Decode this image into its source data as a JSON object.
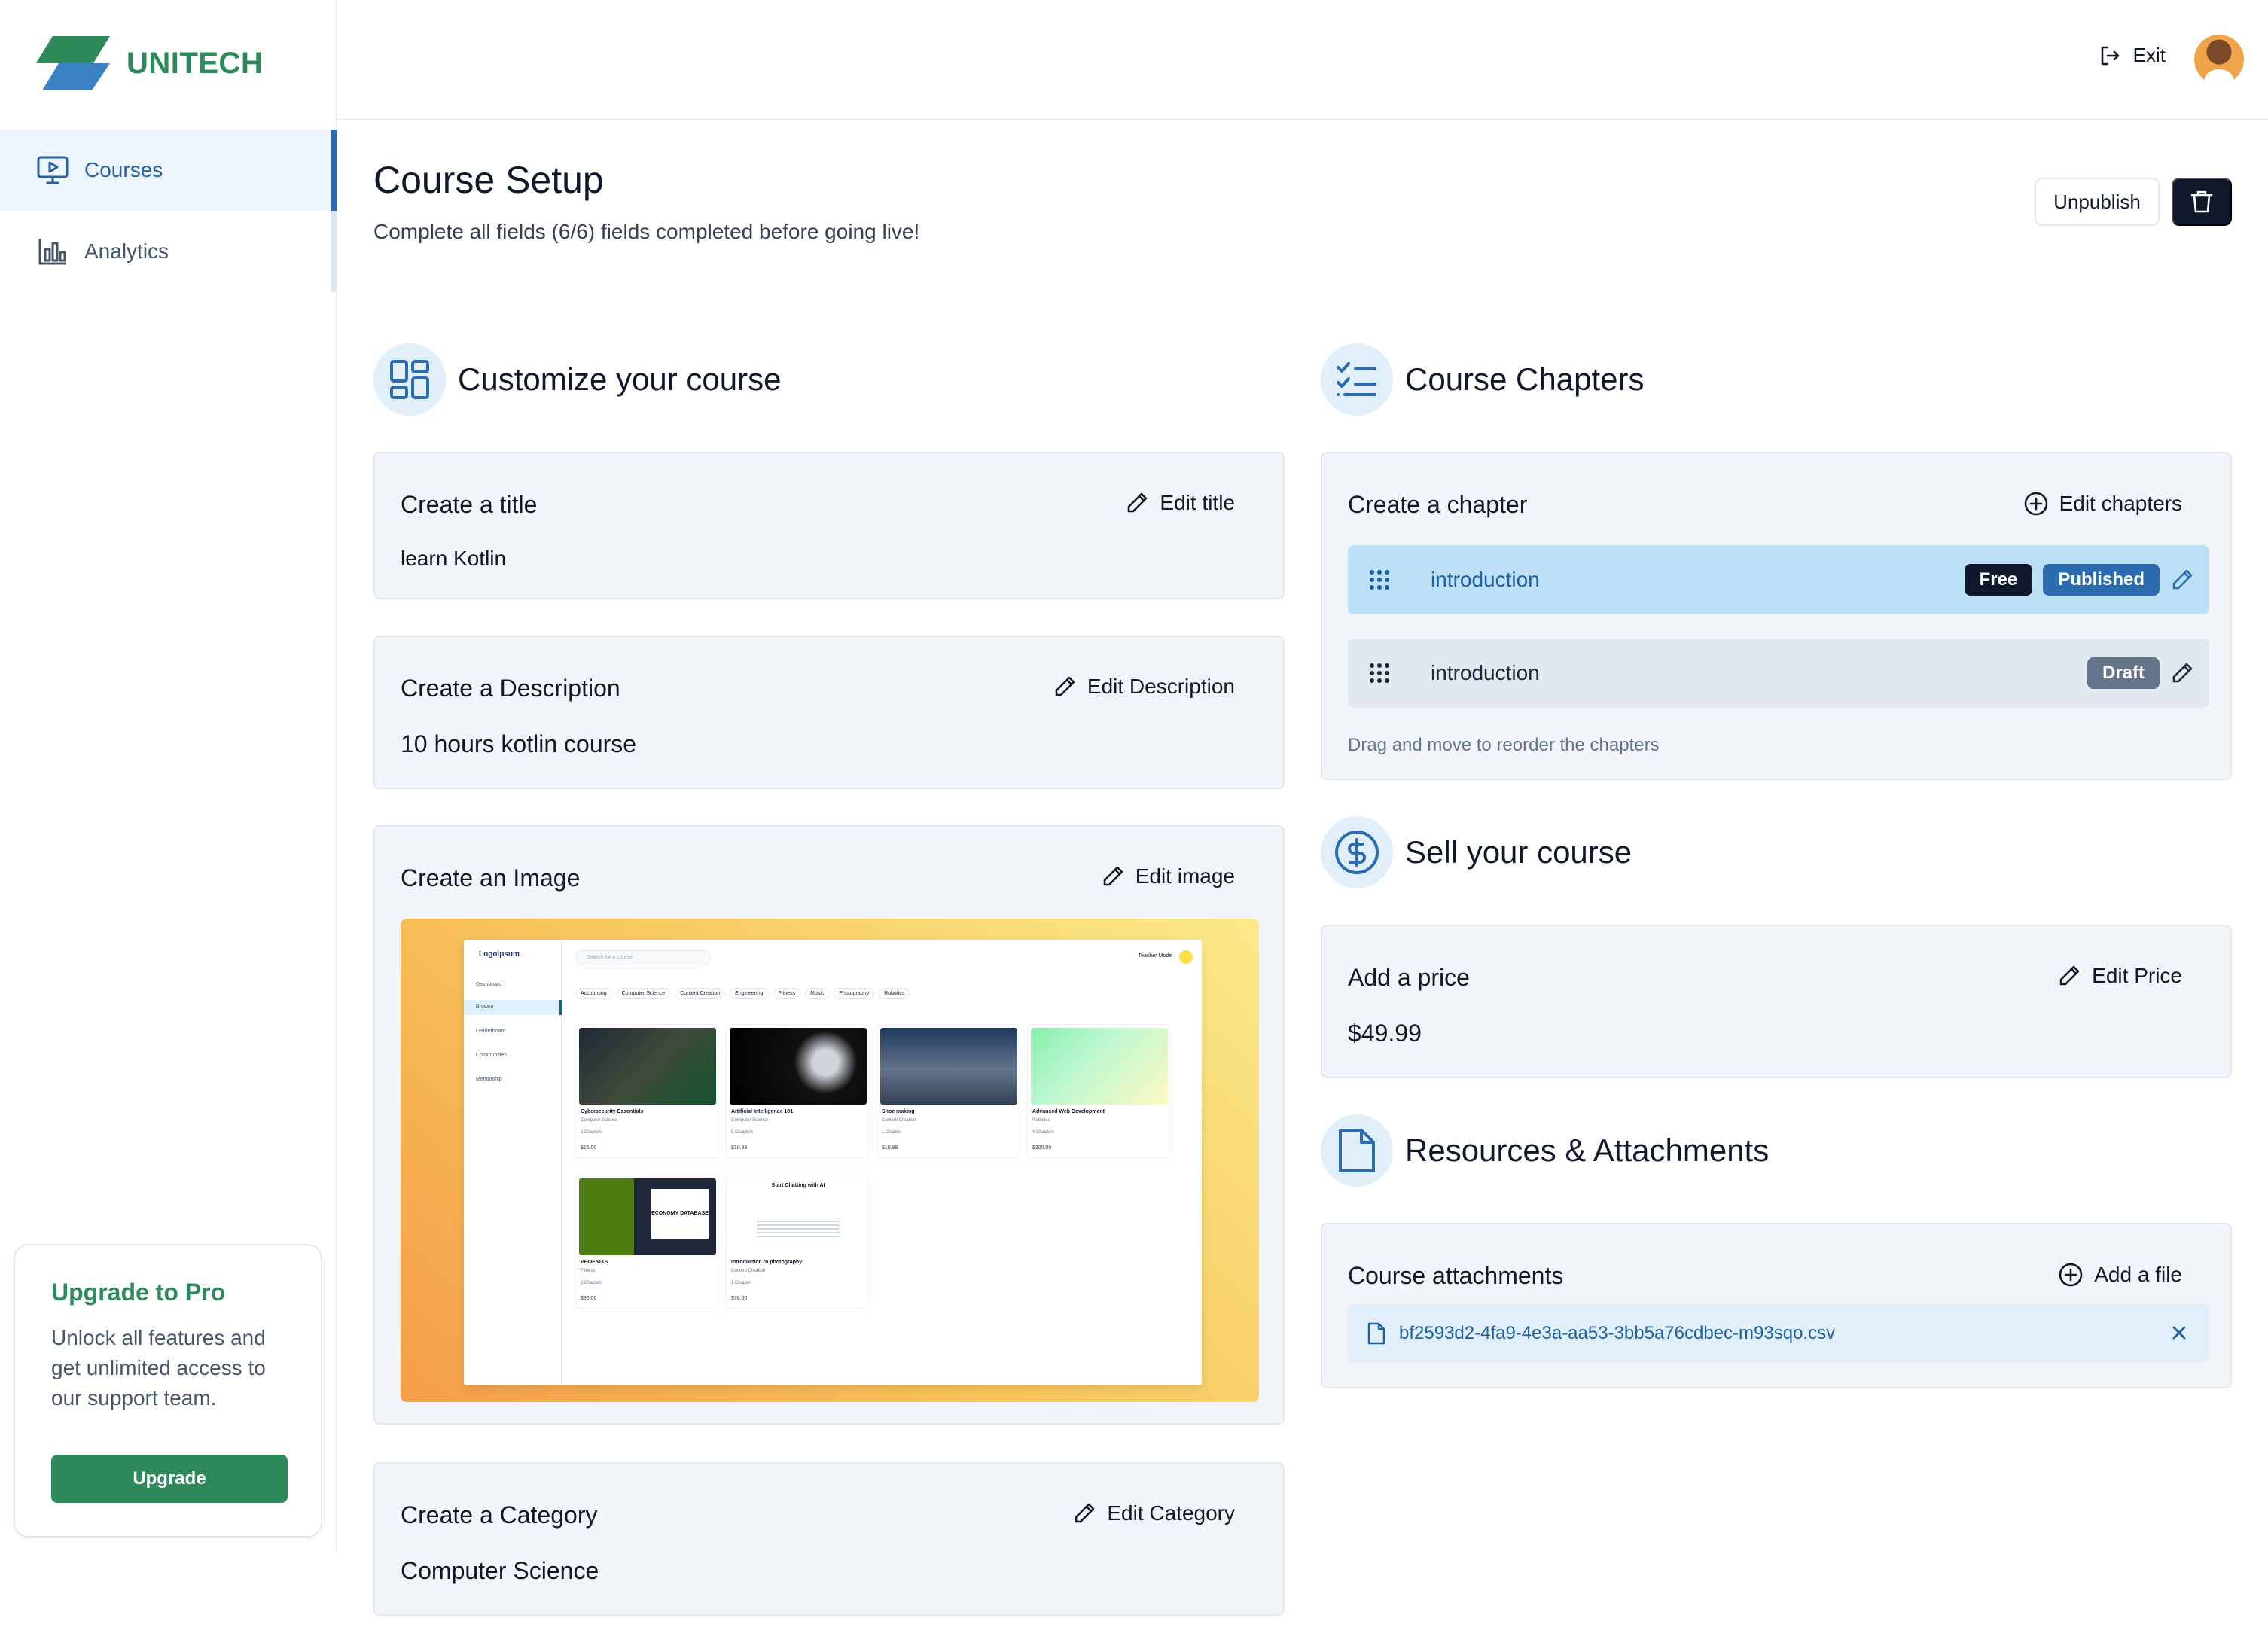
{
  "brand": {
    "name": "UNITECH"
  },
  "sidebar": {
    "items": [
      {
        "label": "Courses",
        "icon": "monitor-play-icon",
        "active": true
      },
      {
        "label": "Analytics",
        "icon": "bar-chart-icon",
        "active": false
      }
    ]
  },
  "upgrade": {
    "title": "Upgrade to Pro",
    "text": "Unlock all features and get unlimited access to our support team.",
    "button": "Upgrade"
  },
  "topbar": {
    "exit_label": "Exit"
  },
  "page": {
    "title": "Course Setup",
    "subtitle": "Complete all fields (6/6) fields completed before going live!",
    "unpublish_label": "Unpublish"
  },
  "customize": {
    "heading": "Customize your course",
    "title_card": {
      "title": "Create a title",
      "action": "Edit title",
      "value": "learn Kotlin"
    },
    "description_card": {
      "title": "Create a Description",
      "action": "Edit Description",
      "value": "10 hours kotlin course"
    },
    "image_card": {
      "title": "Create an Image",
      "action": "Edit image"
    },
    "category_card": {
      "title": "Create a Category",
      "action": "Edit Category",
      "value": "Computer Science"
    }
  },
  "preview": {
    "logo": "Logoipsum",
    "search_placeholder": "Search for a course",
    "teacher_mode": "Teacher Mode",
    "nav": [
      "Dashboard",
      "Browse",
      "Leaderboard",
      "Communities",
      "Mentorship"
    ],
    "categories": [
      "Accounting",
      "Computer Science",
      "Content Creation",
      "Engineering",
      "Fitness",
      "Music",
      "Photography",
      "Robotics"
    ],
    "courses": [
      {
        "title": "Cybersecurity Essentials",
        "category": "Computer Science",
        "chapters": "6 Chapters",
        "price": "$15.00"
      },
      {
        "title": "Artificial Intelligence 101",
        "category": "Computer Science",
        "chapters": "5 Chapters",
        "price": "$10.99"
      },
      {
        "title": "Shoe making",
        "category": "Content Creation",
        "chapters": "1 Chapter",
        "price": "$10.99"
      },
      {
        "title": "Advanced Web Development",
        "category": "Robotics",
        "chapters": "4 Chapters",
        "price": "$300.00"
      },
      {
        "title": "PHOENIXS",
        "category": "Fitness",
        "chapters": "2 Chapters",
        "price": "$30.00"
      },
      {
        "title": "Introduction to photography",
        "category": "Content Creation",
        "chapters": "1 Chapter",
        "price": "$78.00"
      }
    ],
    "economy_label": "ECONOMY DATABASE",
    "chat_label": "Start Chatting with AI"
  },
  "chapters": {
    "heading": "Course Chapters",
    "card_title": "Create a chapter",
    "action": "Edit chapters",
    "items": [
      {
        "title": "introduction",
        "badges": [
          "Free",
          "Published"
        ]
      },
      {
        "title": "introduction",
        "badges": [
          "Draft"
        ]
      }
    ],
    "hint": "Drag and move to reorder the chapters"
  },
  "sell": {
    "heading": "Sell your course",
    "card_title": "Add a price",
    "action": "Edit Price",
    "value": "$49.99"
  },
  "resources": {
    "heading": "Resources & Attachments",
    "card_title": "Course attachments",
    "action": "Add a file",
    "file_name": "bf2593d2-4fa9-4e3a-aa53-3bb5a76cdbec-m93sqo.csv"
  },
  "colors": {
    "brand_green": "#2f8a5b",
    "accent_blue": "#2b6cb0",
    "dark": "#0f172a",
    "card_bg": "#f1f5f9",
    "chapter_published_bg": "#bde0f7"
  }
}
